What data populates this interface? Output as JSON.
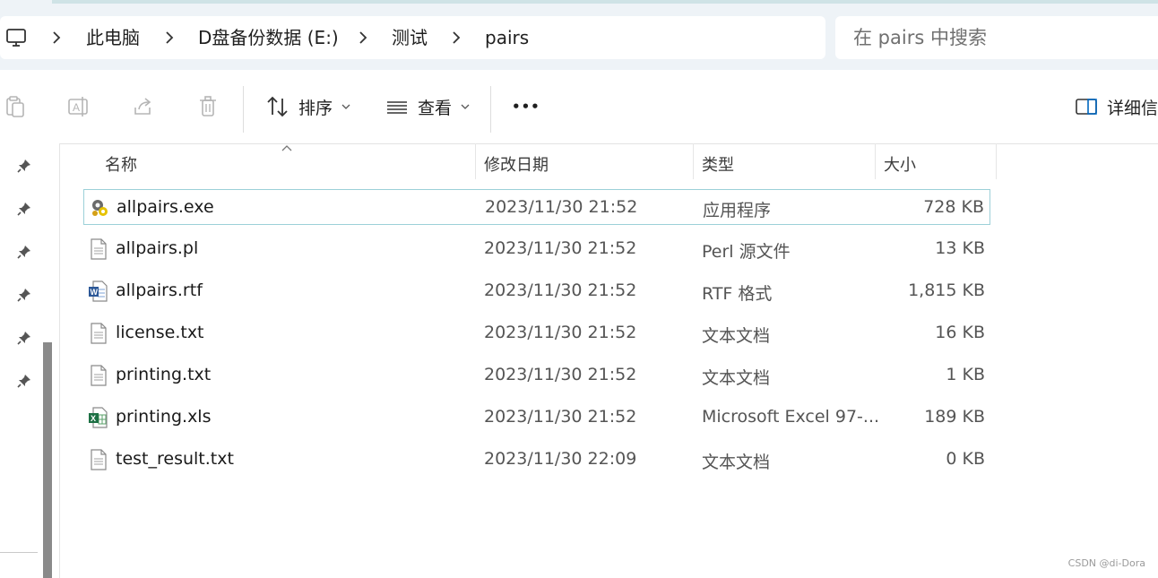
{
  "breadcrumb": {
    "items": [
      "此电脑",
      "D盘备份数据 (E:)",
      "测试",
      "pairs"
    ]
  },
  "search": {
    "placeholder": "在 pairs 中搜索"
  },
  "toolbar": {
    "sort_label": "排序",
    "view_label": "查看",
    "more_label": "•••",
    "details_label": "详细信息"
  },
  "columns": {
    "name": "名称",
    "modified": "修改日期",
    "type": "类型",
    "size": "大小"
  },
  "files": [
    {
      "name": "allpairs.exe",
      "modified": "2023/11/30 21:52",
      "type": "应用程序",
      "size": "728 KB",
      "icon": "exe-icon",
      "selected": true
    },
    {
      "name": "allpairs.pl",
      "modified": "2023/11/30 21:52",
      "type": "Perl 源文件",
      "size": "13 KB",
      "icon": "text-file-icon"
    },
    {
      "name": "allpairs.rtf",
      "modified": "2023/11/30 21:52",
      "type": "RTF 格式",
      "size": "1,815 KB",
      "icon": "word-file-icon"
    },
    {
      "name": "license.txt",
      "modified": "2023/11/30 21:52",
      "type": "文本文档",
      "size": "16 KB",
      "icon": "text-file-icon"
    },
    {
      "name": "printing.txt",
      "modified": "2023/11/30 21:52",
      "type": "文本文档",
      "size": "1 KB",
      "icon": "text-file-icon"
    },
    {
      "name": "printing.xls",
      "modified": "2023/11/30 21:52",
      "type": "Microsoft Excel 97-...",
      "size": "189 KB",
      "icon": "excel-file-icon"
    },
    {
      "name": "test_result.txt",
      "modified": "2023/11/30 22:09",
      "type": "文本文档",
      "size": "0 KB",
      "icon": "text-file-icon"
    }
  ],
  "watermark": "CSDN @di-Dora",
  "colors": {
    "selection_border": "#9cd0d8",
    "accent": "#0067c0"
  }
}
